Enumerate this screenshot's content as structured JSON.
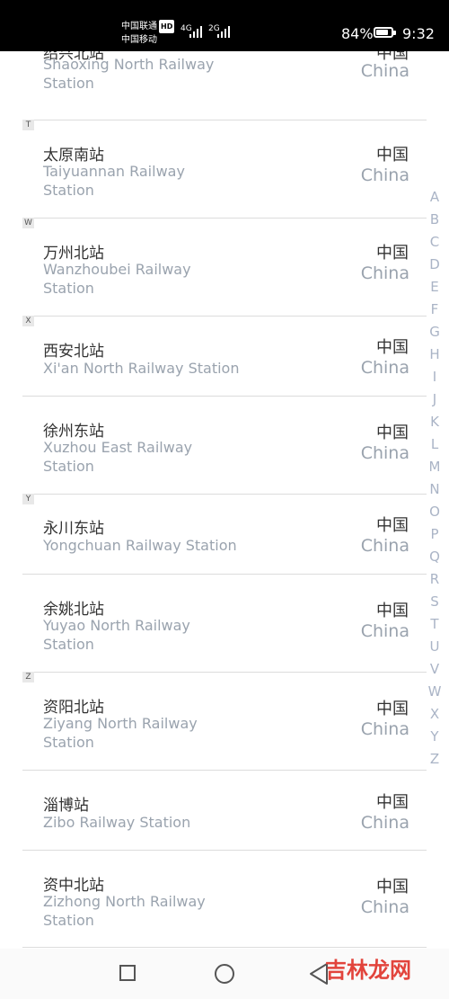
{
  "status_bar": {
    "carrier1": "中国联通",
    "hd_badge": "HD",
    "carrier2": "中国移动",
    "signal1": "4G",
    "signal2": "2G",
    "battery": "84%",
    "battery_level": 0.84,
    "time": "9:32"
  },
  "stations": [
    {
      "zh": "绍兴北站",
      "en": "Shaoxing North Railway Station",
      "country_zh": "中国",
      "country_en": "China"
    },
    {
      "zh": "太原南站",
      "en": "Taiyuannan Railway Station",
      "country_zh": "中国",
      "country_en": "China"
    },
    {
      "zh": "万州北站",
      "en": "Wanzhoubei Railway Station",
      "country_zh": "中国",
      "country_en": "China"
    },
    {
      "zh": "西安北站",
      "en": "Xi'an North Railway Station",
      "country_zh": "中国",
      "country_en": "China"
    },
    {
      "zh": "徐州东站",
      "en": "Xuzhou East Railway Station",
      "country_zh": "中国",
      "country_en": "China"
    },
    {
      "zh": "永川东站",
      "en": "Yongchuan Railway Station",
      "country_zh": "中国",
      "country_en": "China"
    },
    {
      "zh": "余姚北站",
      "en": "Yuyao North Railway Station",
      "country_zh": "中国",
      "country_en": "China"
    },
    {
      "zh": "资阳北站",
      "en": "Ziyang North Railway Station",
      "country_zh": "中国",
      "country_en": "China"
    },
    {
      "zh": "淄博站",
      "en": "Zibo Railway Station",
      "country_zh": "中国",
      "country_en": "China"
    },
    {
      "zh": "资中北站",
      "en": "Zizhong North Railway Station",
      "country_zh": "中国",
      "country_en": "China"
    }
  ],
  "section_letters": [
    "T",
    "W",
    "X",
    "Y",
    "Z"
  ],
  "alpha_index": [
    "A",
    "B",
    "C",
    "D",
    "E",
    "F",
    "G",
    "H",
    "I",
    "J",
    "K",
    "L",
    "M",
    "N",
    "O",
    "P",
    "Q",
    "R",
    "S",
    "T",
    "U",
    "V",
    "W",
    "X",
    "Y",
    "Z"
  ],
  "nav": {
    "recents": "square-icon",
    "home": "circle-icon",
    "back": "triangle-back-icon"
  },
  "watermark": "吉林龙网"
}
